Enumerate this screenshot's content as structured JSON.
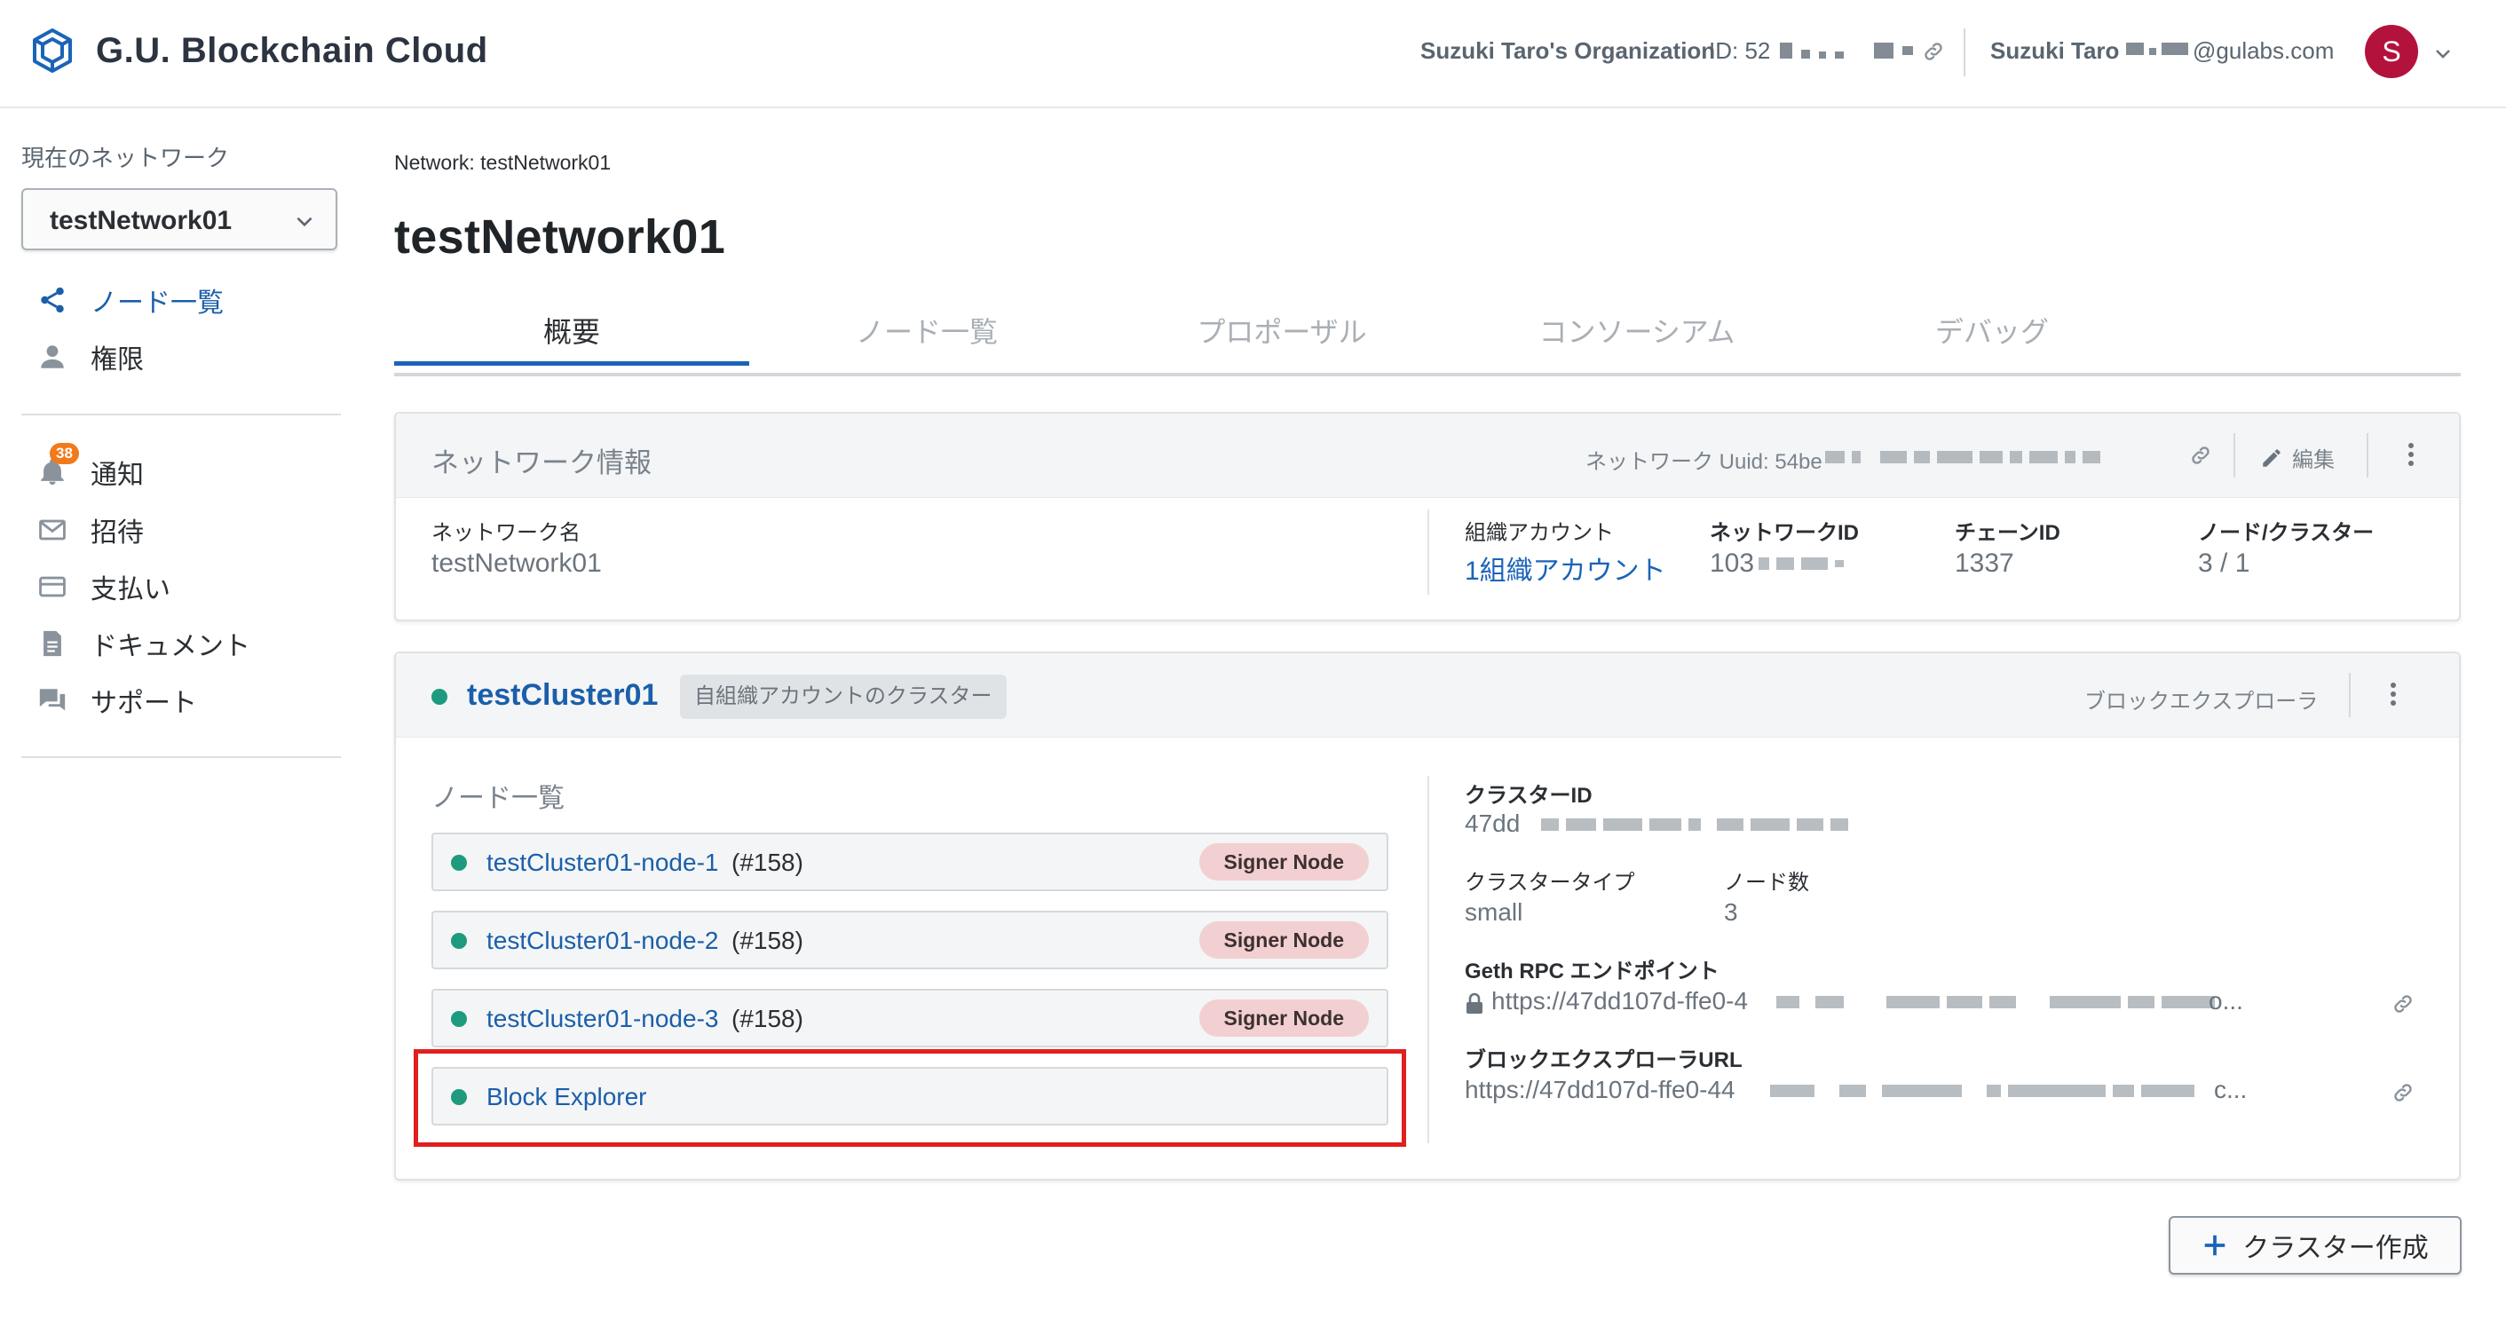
{
  "colors": {
    "accent": "#1a64b8",
    "status_ok": "#1e9a7e",
    "badge": "#f07a1c",
    "signer_pill": "#f2cfd0",
    "highlight": "#e01f1f",
    "avatar": "#b3123d"
  },
  "header": {
    "app_title": "G.U. Blockchain Cloud",
    "organization": "Suzuki Taro's Organization",
    "org_id_prefix": "ID: 52",
    "user_name": "Suzuki Taro",
    "user_email_suffix": "@gulabs.com",
    "avatar_initial": "S"
  },
  "sidebar": {
    "current_network_label": "現在のネットワーク",
    "selected_network": "testNetwork01",
    "nav": [
      {
        "label": "ノード一覧",
        "icon": "share-icon",
        "active": true
      },
      {
        "label": "権限",
        "icon": "person-icon"
      }
    ],
    "secondary": [
      {
        "label": "通知",
        "icon": "bell-icon",
        "badge": "38"
      },
      {
        "label": "招待",
        "icon": "mail-icon"
      },
      {
        "label": "支払い",
        "icon": "credit-card-icon"
      },
      {
        "label": "ドキュメント",
        "icon": "document-icon"
      },
      {
        "label": "サポート",
        "icon": "chat-icon"
      }
    ]
  },
  "main": {
    "breadcrumb": "Network: testNetwork01",
    "title": "testNetwork01",
    "tabs": [
      {
        "label": "概要",
        "active": true
      },
      {
        "label": "ノード一覧"
      },
      {
        "label": "プロポーザル"
      },
      {
        "label": "コンソーシアム"
      },
      {
        "label": "デバッグ"
      }
    ],
    "network_info": {
      "title": "ネットワーク情報",
      "uuid_label": "ネットワーク Uuid: 54be",
      "edit_label": "編集",
      "fields": {
        "network_name_label": "ネットワーク名",
        "network_name_value": "testNetwork01",
        "org_account_label": "組織アカウント",
        "org_account_value": "1組織アカウント",
        "network_id_label": "ネットワークID",
        "network_id_value": "103",
        "chain_id_label": "チェーンID",
        "chain_id_value": "1337",
        "node_cluster_label": "ノード/クラスター",
        "node_cluster_value": "3 / 1"
      }
    },
    "cluster": {
      "name": "testCluster01",
      "tag": "自組織アカウントのクラスター",
      "explorer_link": "ブロックエクスプローラ",
      "node_list_title": "ノード一覧",
      "nodes": [
        {
          "name": "testCluster01-node-1",
          "num": "(#158)",
          "role": "Signer Node"
        },
        {
          "name": "testCluster01-node-2",
          "num": "(#158)",
          "role": "Signer Node"
        },
        {
          "name": "testCluster01-node-3",
          "num": "(#158)",
          "role": "Signer Node"
        }
      ],
      "block_explorer_item": "Block Explorer",
      "details": {
        "cluster_id_label": "クラスターID",
        "cluster_id_value": "47dd",
        "cluster_type_label": "クラスタータイプ",
        "cluster_type_value": "small",
        "node_count_label": "ノード数",
        "node_count_value": "3",
        "geth_rpc_label": "Geth RPC エンドポイント",
        "geth_rpc_value": "https://47dd107d-ffe0-4",
        "geth_rpc_tail": "o...",
        "explorer_url_label": "ブロックエクスプローラURL",
        "explorer_url_value": "https://47dd107d-ffe0-44",
        "explorer_url_tail": "c..."
      }
    },
    "create_cluster_label": "クラスター作成"
  }
}
